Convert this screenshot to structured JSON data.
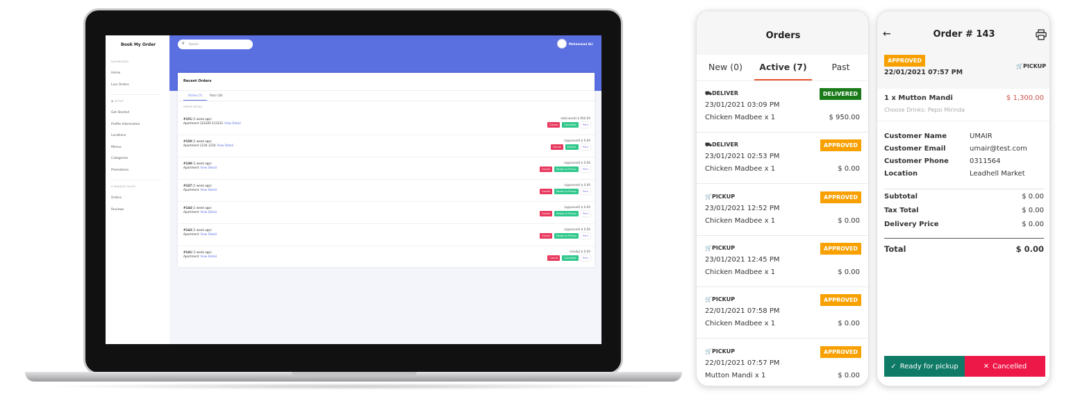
{
  "laptop": {
    "brand": "Book My Order",
    "sidebar": [
      {
        "type": "header",
        "label": "DASHBOARD"
      },
      {
        "type": "item",
        "label": "Home"
      },
      {
        "type": "item",
        "label": "Live Orders"
      },
      {
        "type": "header",
        "label": "▦ SETUP"
      },
      {
        "type": "item",
        "label": "Get Started"
      },
      {
        "type": "item",
        "label": "Profile Information"
      },
      {
        "type": "item",
        "label": "Locations"
      },
      {
        "type": "item",
        "label": "Menus"
      },
      {
        "type": "item",
        "label": "Categories"
      },
      {
        "type": "item",
        "label": "Promotions"
      },
      {
        "type": "header",
        "label": "$ MANAGE SALES"
      },
      {
        "type": "item",
        "label": "Orders"
      },
      {
        "type": "item",
        "label": "Reviews"
      }
    ],
    "search_placeholder": "Search",
    "user_name": "Mohammad ALI",
    "card_title": "Recent Orders",
    "tabs": [
      "Active (7)",
      "Past (18)"
    ],
    "column_header": "ORDER DETAIL",
    "view_detail": "View Detail",
    "orders": [
      {
        "id": "#151",
        "ago": "(1 week ago)",
        "address": "Apartment 122345 213312",
        "status": "(delivered) $ 950.00",
        "actions": [
          "Cancel",
          "Complete",
          "Print"
        ]
      },
      {
        "id": "#150",
        "ago": "(1 week ago)",
        "address": "Apartment 1234 1234",
        "status": "(approved) $ 0.00",
        "actions": [
          "Cancel",
          "Deliver",
          "Print"
        ]
      },
      {
        "id": "#149",
        "ago": "(1 week ago)",
        "address": "Apartment",
        "status": "(approved) $ 0.00",
        "actions": [
          "Cancel",
          "Ready to Pickup",
          "Print"
        ]
      },
      {
        "id": "#147",
        "ago": "(1 week ago)",
        "address": "Apartment",
        "status": "(approved) $ 0.00",
        "actions": [
          "Cancel",
          "Ready to Pickup",
          "Print"
        ]
      },
      {
        "id": "#144",
        "ago": "(1 week ago)",
        "address": "Apartment",
        "status": "(approved) $ 0.00",
        "actions": [
          "Cancel",
          "Ready to Pickup",
          "Print"
        ]
      },
      {
        "id": "#143",
        "ago": "(1 week ago)",
        "address": "Apartment",
        "status": "(approved) $ 0.00",
        "actions": [
          "Cancel",
          "Ready to Pickup",
          "Print"
        ]
      },
      {
        "id": "#141",
        "ago": "(1 week ago)",
        "address": "Apartment",
        "status": "(ready) $ 0.00",
        "actions": [
          "Cancel",
          "Complete",
          "Print"
        ]
      }
    ]
  },
  "orders_phone": {
    "title": "Orders",
    "tabs": [
      "New (0)",
      "Active (7)",
      "Past"
    ],
    "orders": [
      {
        "type": "DELIVER",
        "icon": "truck-icon",
        "date": "23/01/2021 03:09 PM",
        "item": "Chicken Madbee x 1",
        "price": "$ 950.00",
        "badge": "DELIVERED",
        "badge_color": "#1a7a1a"
      },
      {
        "type": "DELIVER",
        "icon": "truck-icon",
        "date": "23/01/2021 02:53 PM",
        "item": "Chicken Madbee x 1",
        "price": "$ 0.00",
        "badge": "APPROVED",
        "badge_color": "#f7a000"
      },
      {
        "type": "PICKUP",
        "icon": "cart-icon",
        "date": "23/01/2021 12:52 PM",
        "item": "Chicken Madbee x 1",
        "price": "$ 0.00",
        "badge": "APPROVED",
        "badge_color": "#f7a000"
      },
      {
        "type": "PICKUP",
        "icon": "cart-icon",
        "date": "23/01/2021 12:45 PM",
        "item": "Chicken Madbee x 1",
        "price": "$ 0.00",
        "badge": "APPROVED",
        "badge_color": "#f7a000"
      },
      {
        "type": "PICKUP",
        "icon": "cart-icon",
        "date": "22/01/2021 07:58 PM",
        "item": "Chicken Madbee x 1",
        "price": "$ 0.00",
        "badge": "APPROVED",
        "badge_color": "#f7a000"
      },
      {
        "type": "PICKUP",
        "icon": "cart-icon",
        "date": "22/01/2021 07:57 PM",
        "item": "Mutton Mandi x 1",
        "price": "$ 0.00",
        "badge": "APPROVED",
        "badge_color": "#f7a000"
      }
    ]
  },
  "detail_phone": {
    "title": "Order # 143",
    "badge": "APPROVED",
    "date": "22/01/2021 07:57 PM",
    "type": "PICKUP",
    "item": "1 x Mutton Mandi",
    "item_price": "$ 1,300.00",
    "item_note": "Choose Drinks: Pepsi Mirinda",
    "customer": [
      {
        "label": "Customer Name",
        "value": "UMAIR"
      },
      {
        "label": "Customer Email",
        "value": "umair@test.com"
      },
      {
        "label": "Customer Phone",
        "value": "0311564"
      },
      {
        "label": "Location",
        "value": "Leadhell Market"
      }
    ],
    "totals": [
      {
        "label": "Subtotal",
        "value": "$ 0.00"
      },
      {
        "label": "Tax Total",
        "value": "$ 0.00"
      },
      {
        "label": "Delivery Price",
        "value": "$ 0.00"
      }
    ],
    "total_label": "Total",
    "total_value": "$ 0.00",
    "ready_label": "Ready for pickup",
    "cancel_label": "Cancelled",
    "colors": {
      "ready": "#0f7a66",
      "cancel": "#ee1848",
      "price": "#c8504a",
      "accent": "#e8532a"
    }
  }
}
